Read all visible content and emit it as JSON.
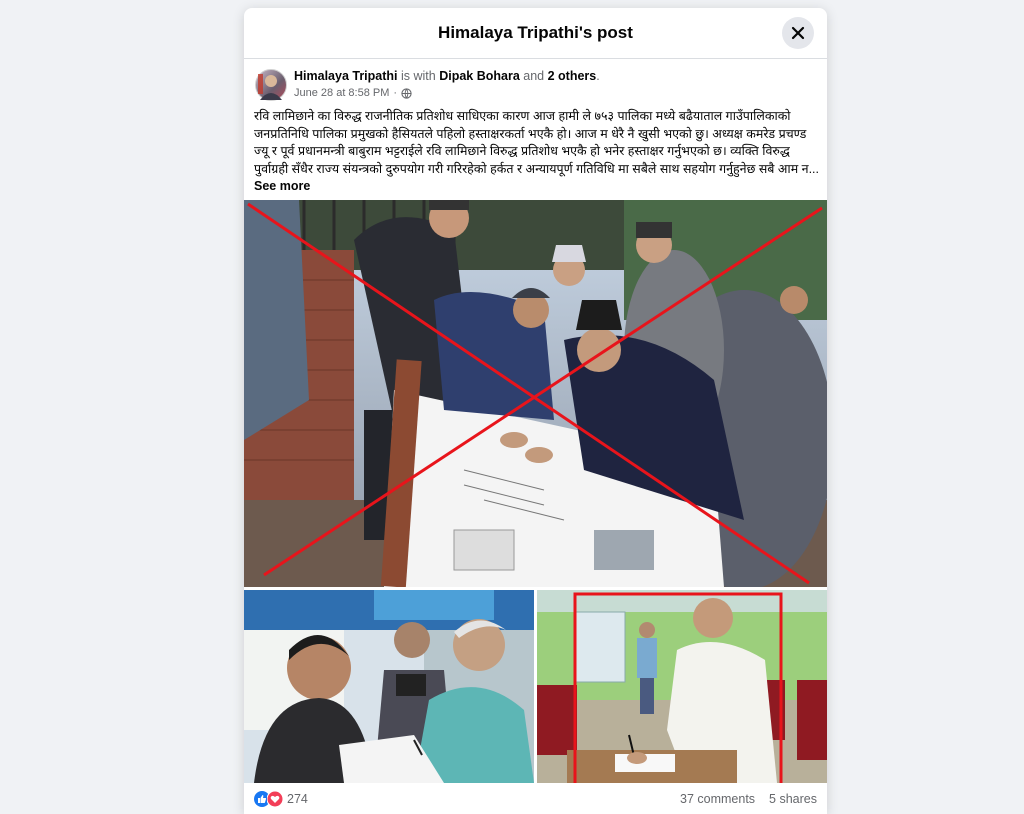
{
  "modal": {
    "title": "Himalaya Tripathi's post"
  },
  "post": {
    "author": "Himalaya Tripathi",
    "with_text": " is with ",
    "tagged": "Dipak Bohara",
    "and_text": " and ",
    "others": "2 others",
    "period": ".",
    "timestamp": "June 28 at 8:58 PM",
    "separator": " · ",
    "text": "रवि लामिछाने का विरुद्ध राजनीतिक प्रतिशोध साधिएका कारण आज हामी ले ७५३ पालिका मध्ये बढैयाताल गाउँपालिकाको जनप्रतिनिधि पालिका प्रमुखको हैसियतले पहिलो हस्ताक्षरकर्ता भएकै हो। आज म धेरै नै खुसी भएको छु। अध्यक्ष कमरेड प्रचण्ड ज्यू र  पूर्व प्रधानमन्त्री बाबुराम भट्टराईले  रवि लामिछाने विरुद्ध प्रतिशोध भएकै हो भनेर हस्ताक्षर गर्नुभएको छ।  व्यक्ति  विरुद्ध पुर्वाग्रही सँधैर राज्य संयन्त्रको दुरुपयोग गरी गरिरहेको हर्कत र अन्यायपूर्ण गतिविधि मा सबैले साथ सहयोग गर्नुहुनेछ सबै आम न...",
    "see_more": "See more"
  },
  "footer": {
    "reaction_count": "274",
    "comments": "37 comments",
    "shares": "5 shares"
  },
  "colors": {
    "facebook_blue": "#1877f2",
    "love_red": "#f33e58",
    "annotation_red": "#e8141b"
  },
  "icons": {
    "close": "close-icon",
    "privacy": "globe-icon",
    "like": "like-icon",
    "love": "love-icon"
  }
}
